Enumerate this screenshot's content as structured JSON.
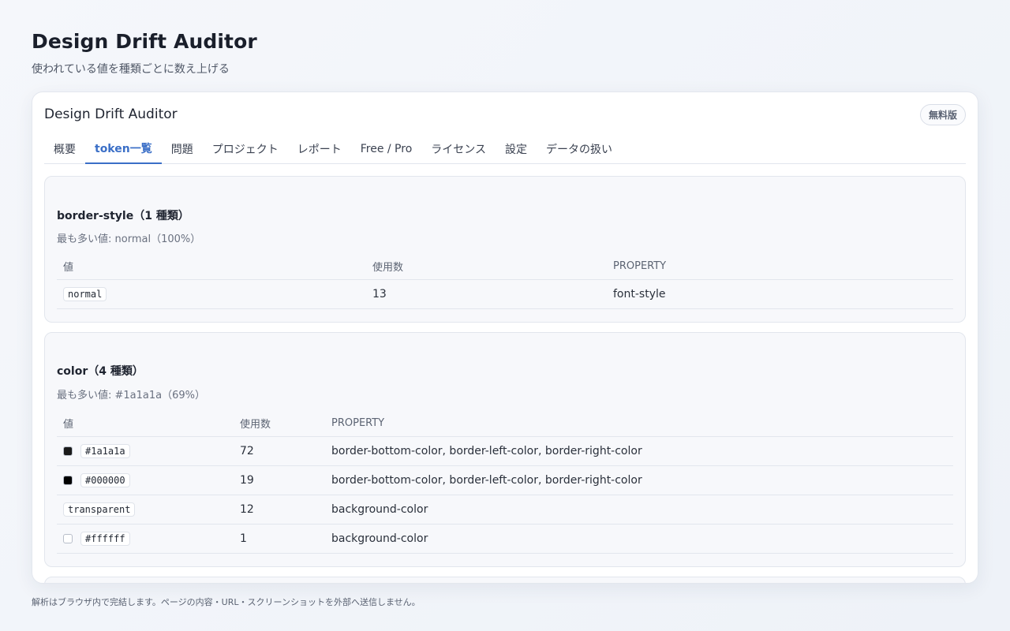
{
  "page": {
    "title": "Design Drift Auditor",
    "subtitle": "使われている値を種類ごとに数え上げる"
  },
  "card": {
    "title": "Design Drift Auditor",
    "badge": "無料版",
    "tabs": [
      {
        "label": "概要"
      },
      {
        "label": "token一覧"
      },
      {
        "label": "問題"
      },
      {
        "label": "プロジェクト"
      },
      {
        "label": "レポート"
      },
      {
        "label": "Free / Pro"
      },
      {
        "label": "ライセンス"
      },
      {
        "label": "設定"
      },
      {
        "label": "データの扱い"
      }
    ],
    "active_tab": "token一覧"
  },
  "sections": [
    {
      "title": "border-style（1 種類）",
      "subtitle": "最も多い値: normal（100%）",
      "headers": {
        "value": "値",
        "count": "使用数",
        "property": "PROPERTY"
      },
      "rows": [
        {
          "value": "normal",
          "count": "13",
          "property": "font-style"
        }
      ]
    },
    {
      "title": "color（4 種類）",
      "subtitle": "最も多い値: #1a1a1a（69%）",
      "headers": {
        "value": "値",
        "count": "使用数",
        "property": "PROPERTY"
      },
      "rows": [
        {
          "value": "#1a1a1a",
          "swatch": "#1a1a1a",
          "count": "72",
          "property": "border-bottom-color, border-left-color, border-right-color"
        },
        {
          "value": "#000000",
          "swatch": "#000000",
          "count": "19",
          "property": "border-bottom-color, border-left-color, border-right-color"
        },
        {
          "value": "transparent",
          "count": "12",
          "property": "background-color"
        },
        {
          "value": "#ffffff",
          "swatch": "#ffffff",
          "count": "1",
          "property": "background-color"
        }
      ]
    }
  ],
  "footer": "解析はブラウザ内で完結します。ページの内容・URL・スクリーンショットを外部へ送信しません。",
  "colors": {
    "accent": "#3b6fc7",
    "background": "#f2f5fa",
    "card": "#ffffff"
  }
}
